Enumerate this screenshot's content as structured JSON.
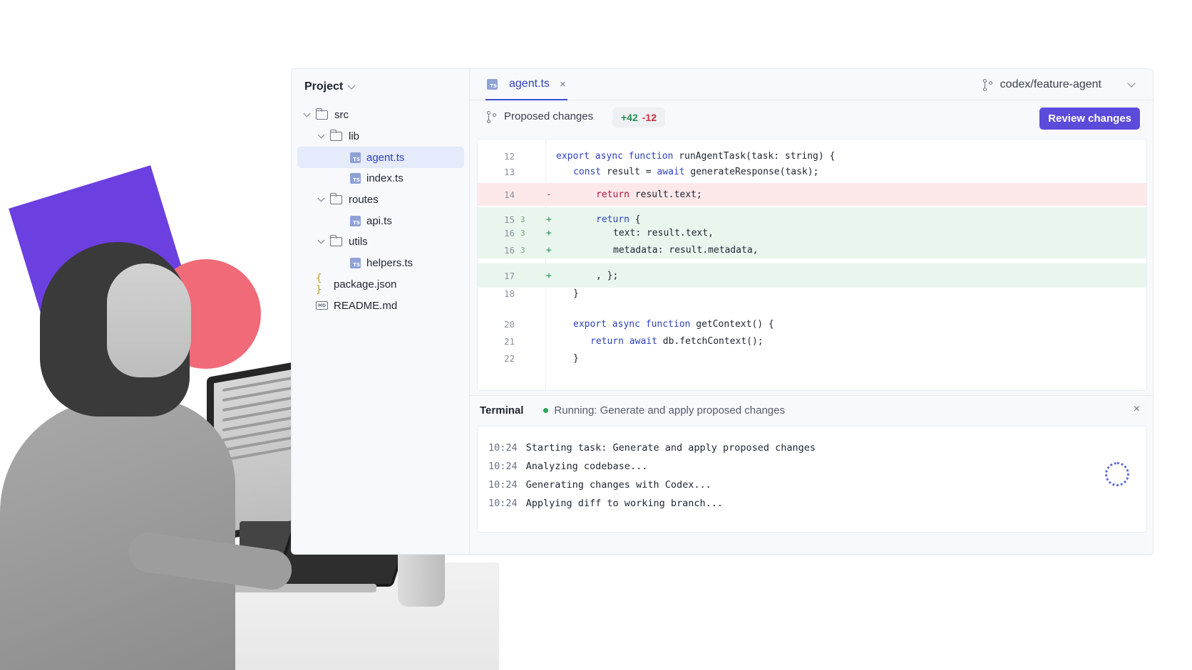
{
  "sidebar": {
    "title": "Project",
    "tree": [
      {
        "label": "src",
        "type": "folder",
        "depth": 0
      },
      {
        "label": "lib",
        "type": "folder",
        "depth": 1
      },
      {
        "label": "agent.ts",
        "type": "ts",
        "depth": 2,
        "active": true
      },
      {
        "label": "index.ts",
        "type": "ts",
        "depth": 2
      },
      {
        "label": "routes",
        "type": "folder",
        "depth": 1
      },
      {
        "label": "api.ts",
        "type": "ts",
        "depth": 2
      },
      {
        "label": "utils",
        "type": "folder",
        "depth": 1
      },
      {
        "label": "helpers.ts",
        "type": "ts",
        "depth": 2
      },
      {
        "label": "package.json",
        "type": "json",
        "depth": 0
      },
      {
        "label": "README.md",
        "type": "md",
        "depth": 0
      }
    ]
  },
  "tabs": [
    {
      "label": "agent.ts",
      "icon_text": "TS",
      "active": true
    }
  ],
  "branch": {
    "name": "codex/feature-agent"
  },
  "changes": {
    "label": "Proposed changes",
    "additions": "+42",
    "deletions": "-12",
    "review_label": "Review changes"
  },
  "code": [
    {
      "num": "12",
      "mark": "",
      "sign": "",
      "kind": "ctx",
      "indent": 0,
      "parts": [
        [
          "kw",
          "export async function "
        ],
        [
          "",
          "runAgentTask("
        ],
        [
          "",
          "task: string"
        ],
        [
          "",
          ") {"
        ]
      ]
    },
    {
      "num": "13",
      "mark": "",
      "sign": "",
      "kind": "ctx",
      "indent": 1,
      "parts": [
        [
          "kw",
          "const "
        ],
        [
          "",
          "result = "
        ],
        [
          "kw",
          "await "
        ],
        [
          "",
          "generateResponse(task);"
        ]
      ]
    },
    {
      "num": "14",
      "mark": "",
      "sign": "-",
      "kind": "removed",
      "indent": 2,
      "parts": [
        [
          "ret",
          "return "
        ],
        [
          "",
          "result.text;"
        ]
      ]
    },
    {
      "num": "15",
      "mark": "3",
      "sign": "+",
      "kind": "added",
      "indent": 2,
      "parts": [
        [
          "kw",
          "return "
        ],
        [
          "",
          "{"
        ]
      ]
    },
    {
      "num": "16",
      "mark": "3",
      "sign": "+",
      "kind": "added",
      "indent": 3,
      "parts": [
        [
          "",
          "text: result.text,"
        ]
      ]
    },
    {
      "num": "16",
      "mark": "3",
      "sign": "+",
      "kind": "added",
      "indent": 3,
      "parts": [
        [
          "",
          "metadata: result.metadata,"
        ]
      ]
    },
    {
      "num": "17",
      "mark": "",
      "sign": "+",
      "kind": "added",
      "indent": 2,
      "parts": [
        [
          "",
          ", };"
        ]
      ]
    },
    {
      "num": "18",
      "mark": "",
      "sign": "",
      "kind": "ctx",
      "indent": 1,
      "parts": [
        [
          "",
          "}"
        ]
      ]
    },
    {
      "num": "20",
      "mark": "",
      "sign": "",
      "kind": "ctx",
      "indent": 1,
      "parts": [
        [
          "kw",
          "export async function "
        ],
        [
          "",
          "getContext() {"
        ]
      ]
    },
    {
      "num": "21",
      "mark": "",
      "sign": "",
      "kind": "ctx",
      "indent": 2,
      "parts": [
        [
          "kw",
          "return await "
        ],
        [
          "",
          "db.fetchContext();"
        ]
      ]
    },
    {
      "num": "22",
      "mark": "",
      "sign": "",
      "kind": "ctx",
      "indent": 1,
      "parts": [
        [
          "",
          "}"
        ]
      ]
    }
  ],
  "terminal": {
    "title": "Terminal",
    "status": "Running: Generate and apply proposed changes",
    "close_icon": "×",
    "lines": [
      {
        "time": "10:24",
        "msg": "Starting task: Generate and apply proposed changes"
      },
      {
        "time": "10:24",
        "msg": "Analyzing codebase..."
      },
      {
        "time": "10:24",
        "msg": "Generating changes with Codex..."
      },
      {
        "time": "10:24",
        "msg": "Applying diff to working branch..."
      }
    ]
  },
  "icons": {
    "tab_close": "×",
    "json_icon": "{ }",
    "md_icon": "MD"
  },
  "colors": {
    "accent": "#5b4bdb",
    "deco_purple": "#6b3fe0",
    "deco_coral": "#f06a78",
    "added": "#23914a",
    "deleted": "#cf2f3a"
  }
}
